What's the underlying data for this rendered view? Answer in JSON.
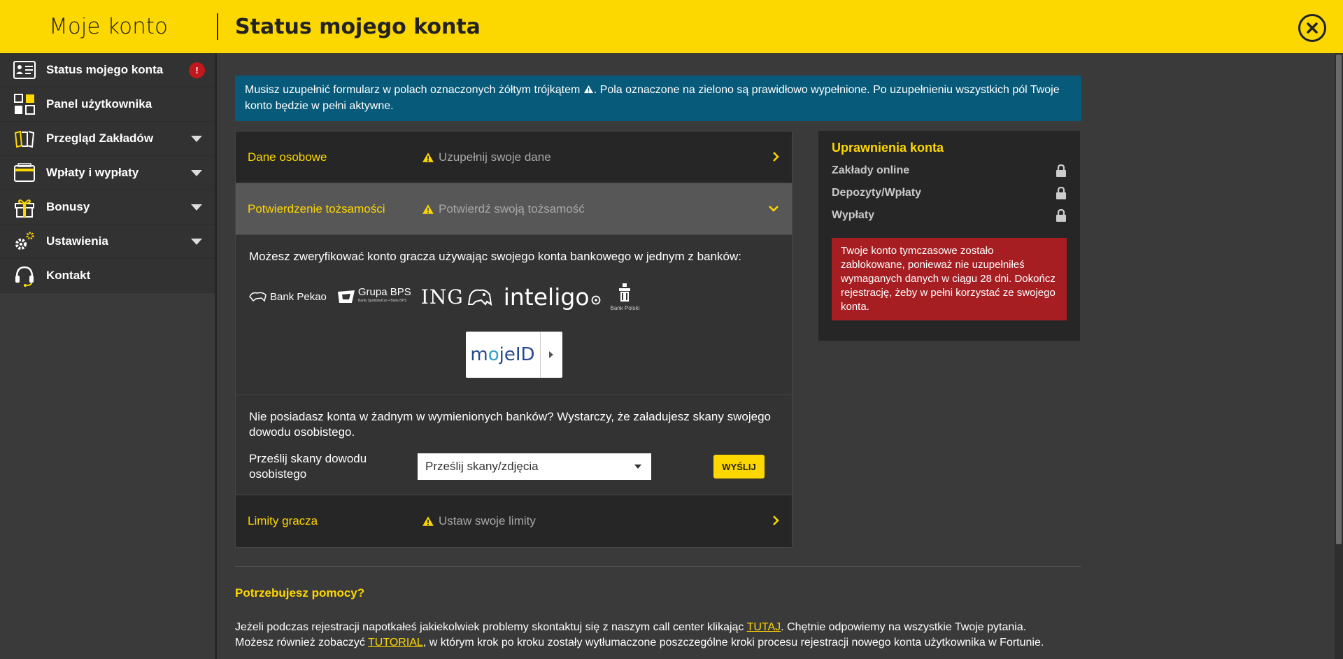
{
  "header": {
    "account_title": "Moje konto",
    "page_title": "Status mojego konta"
  },
  "sidebar": {
    "items": [
      {
        "label": "Status mojego konta",
        "icon": "status-card-icon",
        "badge": "!"
      },
      {
        "label": "Panel użytkownika",
        "icon": "dashboard-grid-icon"
      },
      {
        "label": "Przegląd Zakładów",
        "icon": "betslips-icon"
      },
      {
        "label": "Wpłaty i wypłaty",
        "icon": "wallet-icon"
      },
      {
        "label": "Bonusy",
        "icon": "gift-icon"
      },
      {
        "label": "Ustawienia",
        "icon": "gears-icon"
      },
      {
        "label": "Kontakt",
        "icon": "headset-icon"
      }
    ]
  },
  "banner": {
    "text_before": "Musisz uzupełnić formularz w polach oznaczonych żółtym trójkątem",
    "text_after": ". Pola oznaczone na zielono są prawidłowo wypełnione. Po uzupełnieniu wszystkich pól Twoje konto będzie w pełni aktywne."
  },
  "accordion": {
    "personal": {
      "title": "Dane osobowe",
      "status": "Uzupełnij swoje dane"
    },
    "identity": {
      "title": "Potwierdzenie tożsamości",
      "status": "Potwierdź swoją tożsamość"
    },
    "limits": {
      "title": "Limity gracza",
      "status": "Ustaw swoje limity"
    }
  },
  "identity_body": {
    "intro": "Możesz zweryfikować konto gracza używając swojego konta bankowego w jednym z banków:",
    "banks": {
      "pekao": "Bank Pekao",
      "bps": "Grupa BPS",
      "bps_sub": "Banki Spółdzielcze • Bank BPS",
      "ing": "ING",
      "inteligo": "inteligo",
      "pko_sub": "Bank Polski"
    },
    "mojeid": {
      "moj": "m",
      "o": "o",
      "rest": "jeID"
    },
    "no_account": "Nie posiadasz konta w żadnym w wymienionych banków? Wystarczy, że załadujesz skany swojego dowodu osobistego.",
    "upload_label": "Prześlij skany dowodu osobistego",
    "upload_select": "Prześlij skany/zdjęcia",
    "send_button": "WYŚLIJ"
  },
  "rights": {
    "title": "Uprawnienia konta",
    "items": [
      "Zakłady online",
      "Depozyty/Wpłaty",
      "Wypłaty"
    ],
    "alert": "Twoje konto tymczasowe zostało zablokowane, ponieważ nie uzupełniłeś wymaganych danych w ciągu 28 dni. Dokończ rejestrację, żeby w pełni korzystać ze swojego konta."
  },
  "help": {
    "title": "Potrzebujesz pomocy?",
    "text1": "Jeżeli podczas rejestracji napotkałeś jakiekolwiek problemy skontaktuj się z naszym call center klikając ",
    "link1": "TUTAJ",
    "text2": ". Chętnie odpowiemy na wszystkie Twoje pytania.",
    "text3": "Możesz również zobaczyć ",
    "link2": "TUTORIAL",
    "text4": ", w którym krok po kroku zostały wytłumaczone poszczególne kroki procesu rejestracji nowego konta użytkownika w Fortunie."
  },
  "colors": {
    "brand_yellow": "#fdd700",
    "banner_blue": "#075a79",
    "alert_red": "#a61e22",
    "badge_red": "#c0181c"
  }
}
